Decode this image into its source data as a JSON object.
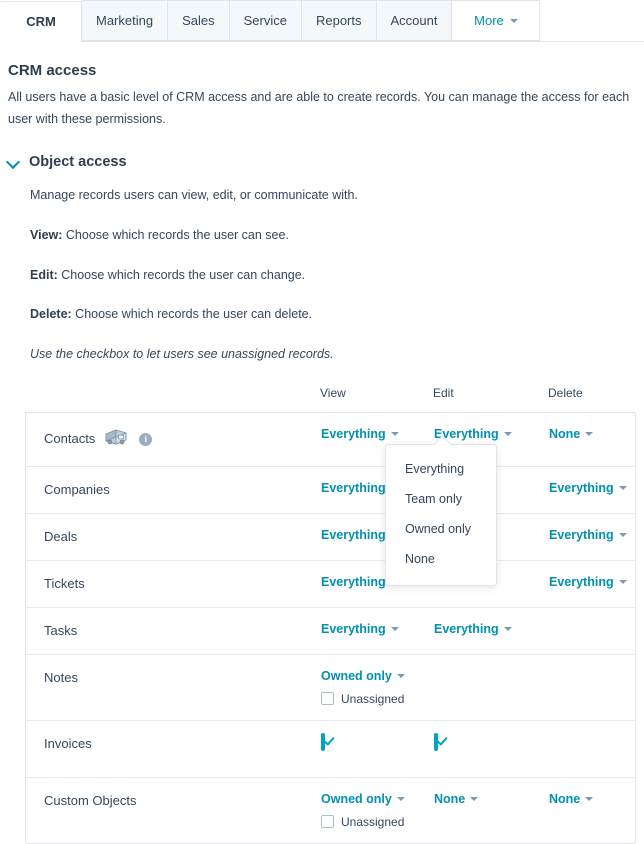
{
  "tabs": [
    {
      "label": "CRM",
      "active": true
    },
    {
      "label": "Marketing",
      "active": false
    },
    {
      "label": "Sales",
      "active": false
    },
    {
      "label": "Service",
      "active": false
    },
    {
      "label": "Reports",
      "active": false
    },
    {
      "label": "Account",
      "active": false
    },
    {
      "label": "More",
      "active": false,
      "caret": true
    }
  ],
  "page": {
    "title": "CRM access",
    "description": "All users have a basic level of CRM access and are able to create records. You can manage the access for each user with these permissions."
  },
  "object_access": {
    "title": "Object access",
    "intro": "Manage records users can view, edit, or communicate with.",
    "definitions": [
      {
        "term": "View:",
        "text": " Choose which records the user can see."
      },
      {
        "term": "Edit:",
        "text": " Choose which records the user can change."
      },
      {
        "term": "Delete:",
        "text": " Choose which records the user can delete."
      }
    ],
    "note": "Use the checkbox to let users see unassigned records."
  },
  "table": {
    "columns": {
      "name": "",
      "view": "View",
      "edit": "Edit",
      "delete": "Delete"
    },
    "rows": [
      {
        "name": "Contacts",
        "icons": [
          "truck-icon",
          "info-icon"
        ],
        "view": "Everything",
        "edit": "Everything",
        "delete": "None",
        "unassigned": null
      },
      {
        "name": "Companies",
        "view": "Everything",
        "edit": "",
        "delete": "Everything",
        "unassigned": null
      },
      {
        "name": "Deals",
        "view": "Everything",
        "edit": "",
        "delete": "Everything",
        "unassigned": null
      },
      {
        "name": "Tickets",
        "view": "Everything",
        "edit": "",
        "delete": "Everything",
        "unassigned": null
      },
      {
        "name": "Tasks",
        "view": "Everything",
        "edit": "Everything",
        "delete": "",
        "unassigned": null
      },
      {
        "name": "Notes",
        "view": "Owned only",
        "edit": "",
        "delete": "",
        "unassigned": {
          "label": "Unassigned",
          "checked": false
        }
      },
      {
        "name": "Invoices",
        "view_checkbox": true,
        "view_checked": true,
        "edit_checkbox": true,
        "edit_checked": true,
        "view": "",
        "edit": "",
        "delete": "",
        "unassigned": null
      },
      {
        "name": "Custom Objects",
        "view": "Owned only",
        "edit": "None",
        "delete": "None",
        "unassigned": {
          "label": "Unassigned",
          "checked": false
        }
      }
    ]
  },
  "dropdown": {
    "open": true,
    "anchor_row": "Contacts",
    "anchor_column": "Edit",
    "options": [
      "Everything",
      "Team only",
      "Owned only",
      "None"
    ]
  },
  "colors": {
    "teal": "#0091ae",
    "teal_checkbox": "#00a4bd",
    "text": "#33475b",
    "heading": "#2d3e50",
    "border": "#dfe3eb",
    "tab_inactive_bg": "#f5f8fa"
  }
}
